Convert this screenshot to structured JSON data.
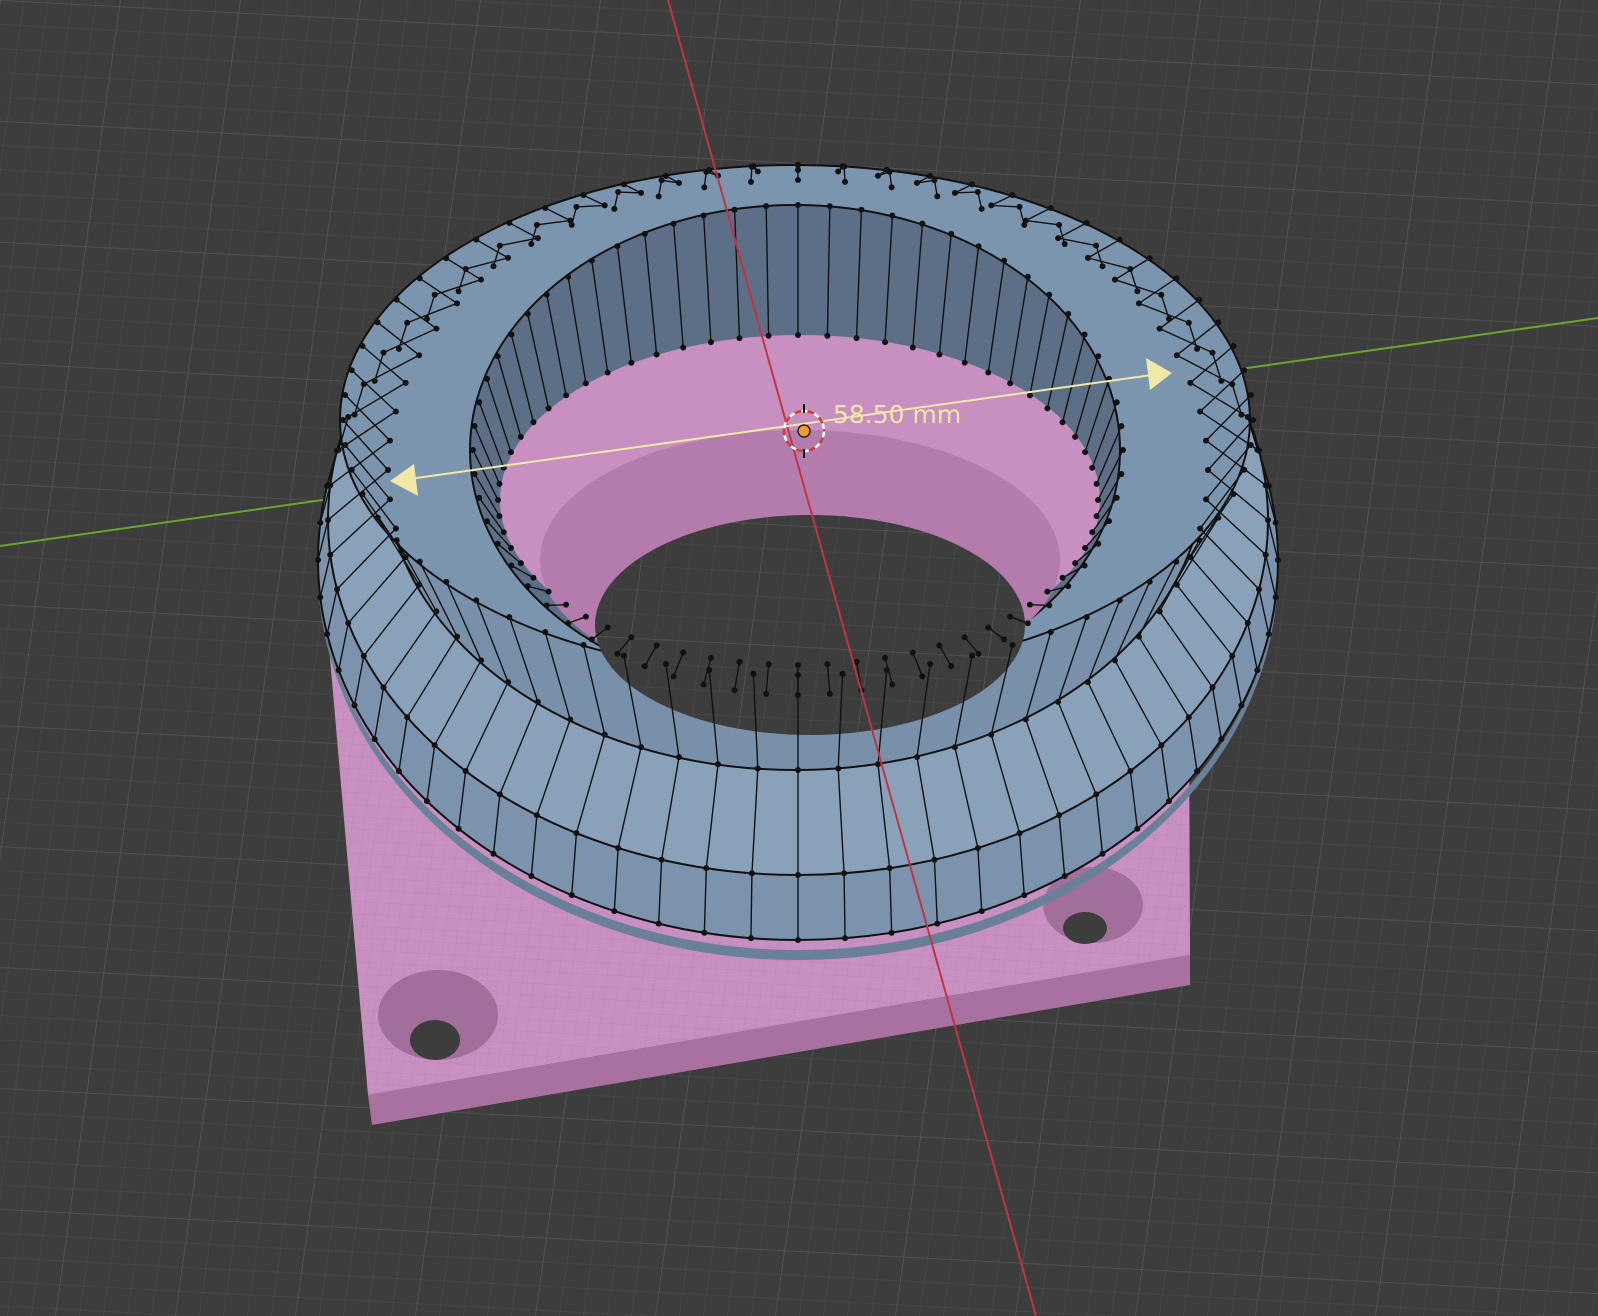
{
  "viewport": {
    "background": "#3d3d3d",
    "grid_color": "#555555",
    "x_axis_color": "#c0353f",
    "y_axis_color": "#6ba52c"
  },
  "objects": {
    "base": {
      "color": "#c890c0",
      "shadow_color": "#a06f9a"
    },
    "ring": {
      "color": "#7890aa",
      "inner_color": "#5c6f86",
      "edge_color": "#111111"
    }
  },
  "measure": {
    "label": "58.50 mm",
    "color": "#f2e8a6"
  },
  "cursor_3d": {
    "icon": "3d-cursor-icon"
  },
  "origin": {
    "icon": "origin-dot-icon",
    "color": "#f39a2a"
  }
}
